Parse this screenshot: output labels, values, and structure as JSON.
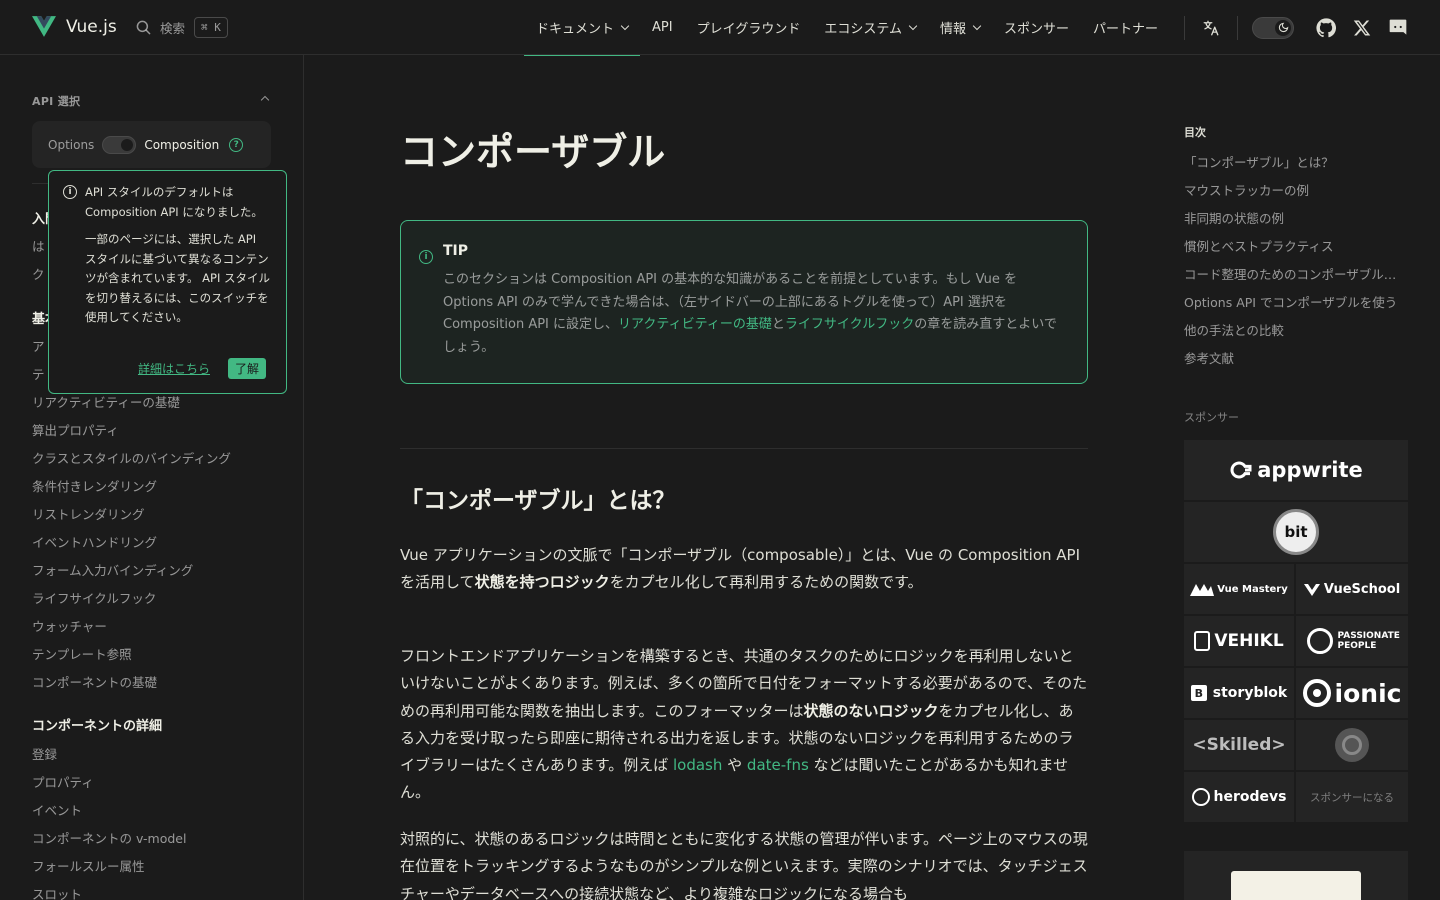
{
  "nav": {
    "brand": "Vue.js",
    "search_label": "検索",
    "search_kbd": "⌘ K",
    "items": [
      {
        "label": "ドキュメント",
        "dropdown": true
      },
      {
        "label": "API",
        "dropdown": false
      },
      {
        "label": "プレイグラウンド",
        "dropdown": false
      },
      {
        "label": "エコシステム",
        "dropdown": true
      },
      {
        "label": "情報",
        "dropdown": true
      },
      {
        "label": "スポンサー",
        "dropdown": false
      },
      {
        "label": "パートナー",
        "dropdown": false
      }
    ],
    "translate_glyph": "文A"
  },
  "sidebar": {
    "api_pref_title": "API 選択",
    "api_options": {
      "options": "Options",
      "composition": "Composition"
    },
    "group_intro_peek": "入門",
    "intro_items_peek": [
      "は",
      "ク"
    ],
    "group_basics_peek": "基本",
    "basics_items_peek": [
      "ア",
      "テ"
    ],
    "basics_items": [
      "リアクティビティーの基礎",
      "算出プロパティ",
      "クラスとスタイルのバインディング",
      "条件付きレンダリング",
      "リストレンダリング",
      "イベントハンドリング",
      "フォーム入力バインディング",
      "ライフサイクルフック",
      "ウォッチャー",
      "テンプレート参照",
      "コンポーネントの基礎"
    ],
    "group_components": "コンポーネントの詳細",
    "component_items": [
      "登録",
      "プロパティ",
      "イベント",
      "コンポーネントの v-model",
      "フォールスルー属性",
      "スロット"
    ]
  },
  "popup": {
    "p1": "API スタイルのデフォルトは Composition API になりました。",
    "p2": "一部のページには、選択した API スタイルに基づいて異なるコンテンツが含まれています。 API スタイルを切り替えるには、このスイッチを使用してください。",
    "more": "詳細はこちら",
    "ok": "了解"
  },
  "main": {
    "title": "コンポーザブル",
    "tip": {
      "title": "TIP",
      "t1": "このセクションは Composition API の基本的な知識があることを前提としています。もし Vue を Options API のみで学んできた場合は、（左サイドバーの上部にあるトグルを使って）API 選択を Composition API に設定し、",
      "link1": "リアクティビティーの基礎",
      "t2": "と",
      "link2": "ライフサイクルフック",
      "t3": "の章を読み直すとよいでしょう。"
    },
    "h2": "「コンポーザブル」とは？",
    "p1a": "Vue アプリケーションの文脈で「コンポーザブル（composable）」とは、Vue の Composition API を活用して",
    "p1b": "状態を持つロジック",
    "p1c": "をカプセル化して再利用するための関数です。",
    "p2a": "フロントエンドアプリケーションを構築するとき、共通のタスクのためにロジックを再利用しないといけないことがよくあります。例えば、多くの箇所で日付をフォーマットする必要があるので、そのための再利用可能な関数を抽出します。このフォーマッターは",
    "p2b": "状態のないロジック",
    "p2c": "をカプセル化し、ある入力を受け取ったら即座に期待される出力を返します。状態のないロジックを再利用するためのライブラリーはたくさんあります。例えば ",
    "p2d": "lodash",
    "p2e": " や ",
    "p2f": "date-fns",
    "p2g": " などは聞いたことがあるかも知れません。",
    "p3": "対照的に、状態のあるロジックは時間とともに変化する状態の管理が伴います。ページ上のマウスの現在位置をトラッキングするようなものがシンプルな例といえます。実際のシナリオでは、タッチジェスチャーやデータベースへの接続状態など、より複雑なロジックになる場合も"
  },
  "aside": {
    "toc_title": "目次",
    "toc": [
      "「コンポーザブル」とは？",
      "マウストラッカーの例",
      "非同期の状態の例",
      "慣例とベストプラクティス",
      "コード整理のためのコンポーザブル抽出",
      "Options API でコンポーザブルを使う",
      "他の手法との比較",
      "参考文献"
    ],
    "sponsors_title": "スポンサー",
    "sponsors": {
      "appwrite": "appwrite",
      "bit": "bit",
      "vue_mastery": "Vue Mastery",
      "vue_school": "VueSchool",
      "vehikl": "VEHIKL",
      "passionate": "PASSIONATE PEOPLE",
      "storyblok": "storyblok",
      "ionic": "ionic",
      "skilled": "<Skilled>",
      "herodevs": "herodevs",
      "become": "スポンサーになる"
    }
  },
  "colors": {
    "accent": "#42b883",
    "bg": "#1b1b1b",
    "panel": "#242424"
  }
}
